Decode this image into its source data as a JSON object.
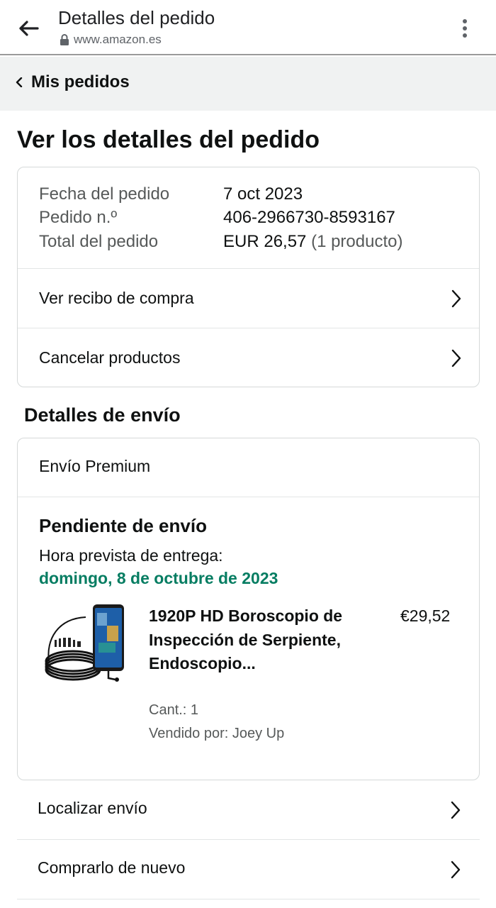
{
  "browser": {
    "page_title": "Detalles del pedido",
    "url": "www.amazon.es",
    "icons": {
      "back": "arrow-left-icon",
      "lock": "lock-icon",
      "menu": "kebab-menu-icon"
    }
  },
  "breadcrumb": {
    "label": "Mis pedidos"
  },
  "page": {
    "heading": "Ver los detalles del pedido"
  },
  "order": {
    "date_label": "Fecha del pedido",
    "date_value": "7 oct 2023",
    "number_label": "Pedido n.º",
    "number_value": "406-2966730-8593167",
    "total_label": "Total del pedido",
    "total_value": "EUR 26,57",
    "total_count": "(1 producto)",
    "links": [
      "Ver recibo de compra",
      "Cancelar productos"
    ]
  },
  "shipping": {
    "heading": "Detalles de envío",
    "type": "Envío Premium",
    "status": "Pendiente de envío",
    "eta_label": "Hora prevista de entrega:",
    "eta_date": "domingo, 8 de octubre de 2023",
    "eta_color": "#067d62",
    "product": {
      "title": "1920P HD Boroscopio de Inspección de Serpiente, Endoscopio...",
      "price": "€29,52",
      "qty": "Cant.: 1",
      "seller": "Vendido por: Joey Up"
    }
  },
  "actions": [
    "Localizar envío",
    "Comprarlo de nuevo"
  ]
}
